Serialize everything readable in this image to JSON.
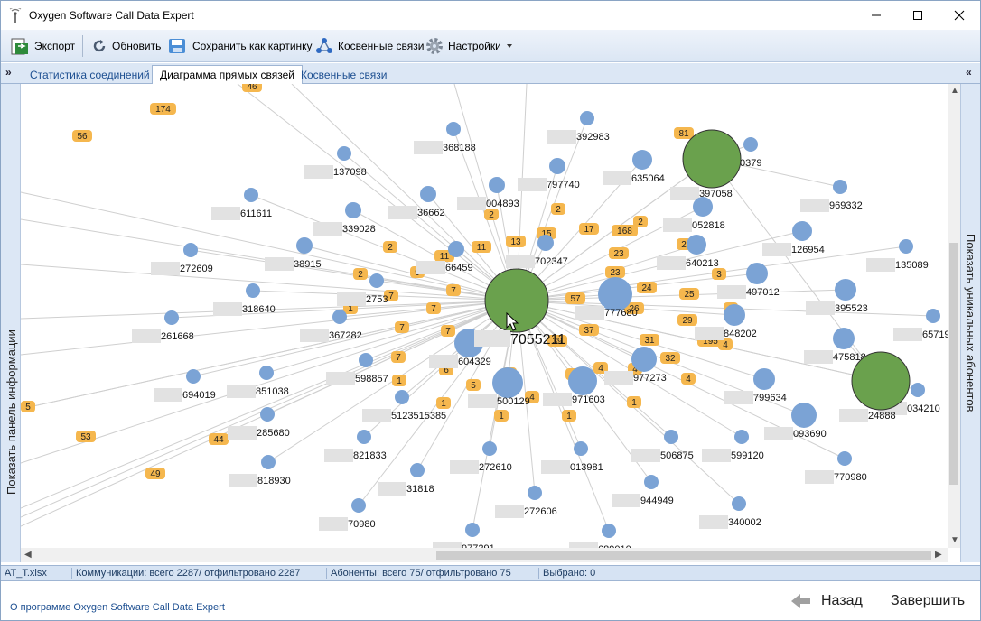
{
  "window": {
    "title": "Oxygen Software Call Data Expert"
  },
  "toolbar": {
    "export_label": "Экспорт",
    "refresh_label": "Обновить",
    "save_image_label": "Сохранить как картинку",
    "indirect_label": "Косвенные связи",
    "settings_label": "Настройки"
  },
  "tabs": [
    {
      "label": "Статистика соединений"
    },
    {
      "label": "Диаграмма прямых связей"
    },
    {
      "label": "Косвенные связи"
    }
  ],
  "panels": {
    "left_label": "Показать панель информации",
    "right_label": "Показать уникальных абонентов"
  },
  "graph": {
    "center_label": "7055211",
    "nodes": [
      {
        "label": "368188"
      },
      {
        "label": "392983"
      },
      {
        "label": "137098"
      },
      {
        "label": "004893"
      },
      {
        "label": "797740"
      },
      {
        "label": "635064"
      },
      {
        "label": "0379"
      },
      {
        "label": "397058"
      },
      {
        "label": "611611"
      },
      {
        "label": "36662"
      },
      {
        "label": "339028"
      },
      {
        "label": "052818"
      },
      {
        "label": "969332"
      },
      {
        "label": "272609"
      },
      {
        "label": "38915"
      },
      {
        "label": "66459"
      },
      {
        "label": "702347"
      },
      {
        "label": "640213"
      },
      {
        "label": "126954"
      },
      {
        "label": "135089"
      },
      {
        "label": "318640"
      },
      {
        "label": "2753"
      },
      {
        "label": "497012"
      },
      {
        "label": "395523"
      },
      {
        "label": "261668"
      },
      {
        "label": "367282"
      },
      {
        "label": "777680"
      },
      {
        "label": "848202"
      },
      {
        "label": "657194"
      },
      {
        "label": "851038"
      },
      {
        "label": "604329"
      },
      {
        "label": "598857"
      },
      {
        "label": "475818"
      },
      {
        "label": "694019"
      },
      {
        "label": "977273"
      },
      {
        "label": "799634"
      },
      {
        "label": "034210"
      },
      {
        "label": "5123515385"
      },
      {
        "label": "500129"
      },
      {
        "label": "971603"
      },
      {
        "label": "24888"
      },
      {
        "label": "285680"
      },
      {
        "label": "093690"
      },
      {
        "label": "821833"
      },
      {
        "label": "506875"
      },
      {
        "label": "599120"
      },
      {
        "label": "272610"
      },
      {
        "label": "013981"
      },
      {
        "label": "770980"
      },
      {
        "label": "818930"
      },
      {
        "label": "31818"
      },
      {
        "label": "944949"
      },
      {
        "label": "272606"
      },
      {
        "label": "70980"
      },
      {
        "label": "340002"
      },
      {
        "label": "977291"
      },
      {
        "label": "689010"
      }
    ],
    "edge_labels": [
      "46",
      "174",
      "56",
      "81",
      "2",
      "2",
      "17",
      "168",
      "2",
      "11",
      "13",
      "15",
      "2",
      "2",
      "9",
      "11",
      "23",
      "2",
      "23",
      "3",
      "24",
      "7",
      "57",
      "7",
      "25",
      "1",
      "7",
      "26",
      "3",
      "7",
      "37",
      "29",
      "7",
      "6",
      "39",
      "31",
      "195",
      "4",
      "6",
      "7",
      "32",
      "4",
      "1",
      "5",
      "4",
      "4",
      "4",
      "4",
      "1",
      "5",
      "4",
      "1",
      "1",
      "1",
      "5",
      "53",
      "44",
      "49"
    ]
  },
  "status": {
    "file": "AT_T.xlsx",
    "communications": "Коммуникации: всего 2287/ отфильтровано 2287",
    "subscribers": "Абоненты: всего 75/ отфильтровано 75",
    "selected": "Выбрано: 0"
  },
  "footer": {
    "about_label": "О программе Oxygen Software Call Data Expert",
    "back_label": "Назад",
    "finish_label": "Завершить"
  },
  "colors": {
    "node": "#7ba3d5",
    "hub": "#6aa14d",
    "badge": "#f5b74e",
    "edge": "#cfcfcf"
  }
}
